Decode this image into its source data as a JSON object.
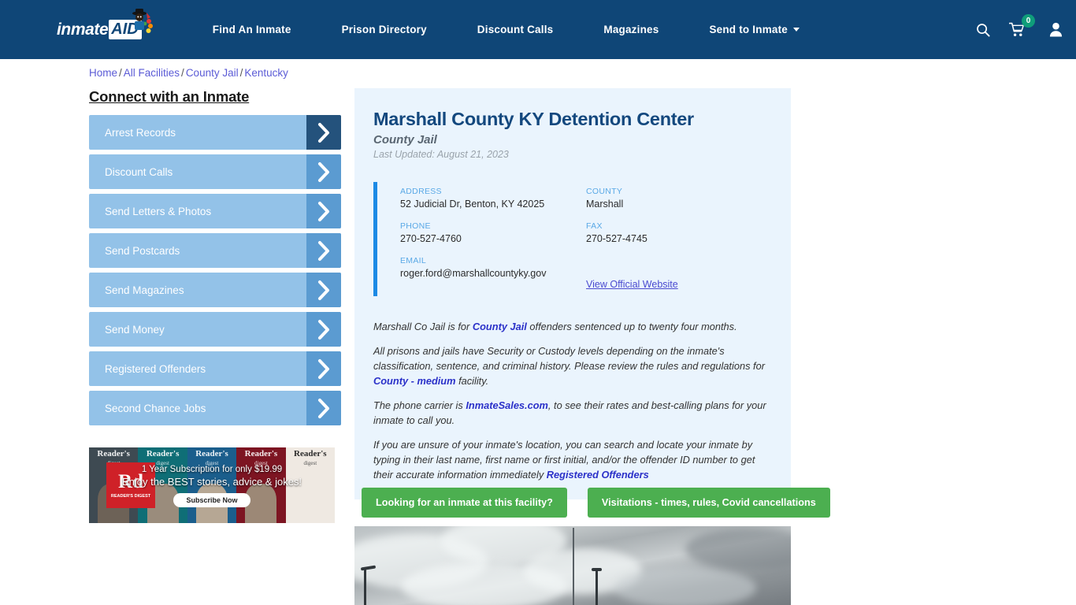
{
  "header": {
    "logo": {
      "text": "inmate",
      "badge": "AID",
      "icon": "mascot-icon"
    },
    "nav": [
      {
        "label": "Find An Inmate",
        "caret": false
      },
      {
        "label": "Prison Directory",
        "caret": false
      },
      {
        "label": "Discount Calls",
        "caret": false
      },
      {
        "label": "Magazines",
        "caret": false
      },
      {
        "label": "Send to Inmate",
        "caret": true
      }
    ],
    "icons": {
      "search": "search-icon",
      "cart": "cart-icon",
      "cart_count": "0",
      "user": "user-icon"
    },
    "colors": {
      "background": "#0f4677",
      "badge": "#0f9d7a"
    }
  },
  "breadcrumb": {
    "separator": "/",
    "items": [
      "Home",
      "All Facilities",
      "County Jail",
      "Kentucky"
    ]
  },
  "sidebar": {
    "heading": "Connect with an Inmate",
    "items": [
      {
        "label": "Arrest Records"
      },
      {
        "label": "Discount Calls"
      },
      {
        "label": "Send Letters & Photos"
      },
      {
        "label": "Send Postcards"
      },
      {
        "label": "Send Magazines"
      },
      {
        "label": "Send Money"
      },
      {
        "label": "Registered Offenders"
      },
      {
        "label": "Second Chance Jobs"
      }
    ]
  },
  "ad": {
    "brand": "Rd",
    "brand_sub": "READER'S DIGEST",
    "line1": "1 Year Subscription for only $19.99",
    "line2": "Enjoy the BEST stories, advice & jokes!",
    "cta": "Subscribe Now",
    "covers": [
      {
        "title": "Reader's",
        "sub": "digest"
      },
      {
        "title": "Reader's",
        "sub": "digest"
      },
      {
        "title": "Reader's",
        "sub": "digest"
      },
      {
        "title": "Reader's",
        "sub": "digest"
      },
      {
        "title": "Reader's",
        "sub": "digest"
      }
    ]
  },
  "facility": {
    "title": "Marshall County KY Detention Center",
    "subtitle": "County Jail",
    "last_updated": "Last Updated: August 21, 2023",
    "contact": {
      "address_label": "ADDRESS",
      "address_value": "52 Judicial Dr, Benton, KY 42025",
      "phone_label": "PHONE",
      "phone_value": "270-527-4760",
      "email_label": "EMAIL",
      "email_value": "roger.ford@marshallcountyky.gov",
      "county_label": "COUNTY",
      "county_value": "Marshall",
      "fax_label": "FAX",
      "fax_value": "270-527-4745",
      "website_link": "View Official Website"
    },
    "paragraphs": {
      "p1_a": "Marshall Co Jail is for ",
      "p1_link": "County Jail",
      "p1_b": " offenders sentenced up to twenty four months.",
      "p2_a": "All prisons and jails have Security or Custody levels depending on the inmate's classification, sentence, and criminal history. Please review the rules and regulations for ",
      "p2_link": "County - medium",
      "p2_b": " facility.",
      "p3_a": "The phone carrier is ",
      "p3_link": "InmateSales.com",
      "p3_b": ", to see their rates and best-calling plans for your inmate to call you.",
      "p4_a": "If you are unsure of your inmate's location, you can search and locate your inmate by typing in their last name, first name or first initial, and/or the offender ID number to get their accurate information immediately ",
      "p4_link": "Registered Offenders"
    }
  },
  "cta_buttons": [
    {
      "label": "Looking for an inmate at this facility?"
    },
    {
      "label": "Visitations - times, rules, Covid cancellations"
    }
  ],
  "photo": {
    "alt": "facility-exterior-cloudy-sky"
  },
  "colors": {
    "header_bg": "#0f4677",
    "panel_bg": "#eaf4fd",
    "accent_bar": "#1d8ae5",
    "sidebar_btn": "#93c2e8",
    "sidebar_arrow": "#5b9bd1",
    "sidebar_arrow_active": "#24527c",
    "cta_green": "#4caf50",
    "link_blue": "#2b31c9"
  }
}
